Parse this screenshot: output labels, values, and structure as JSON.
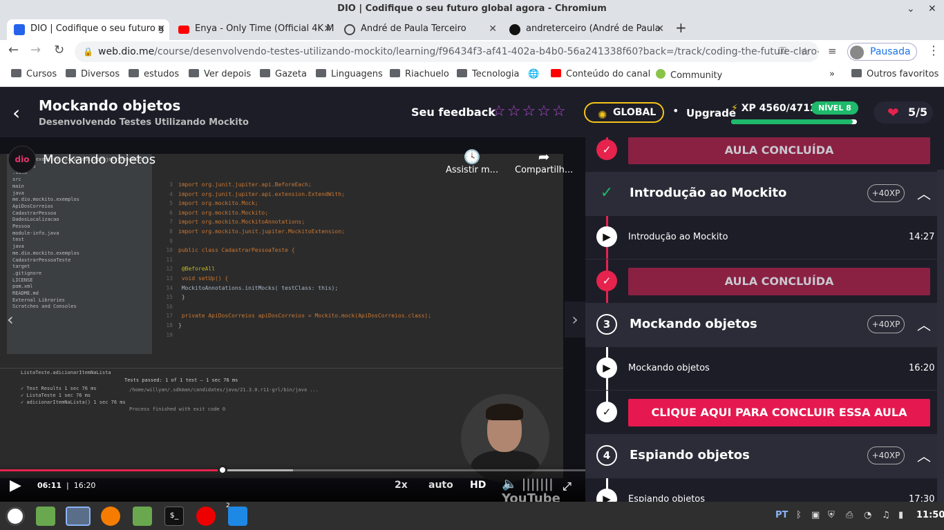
{
  "window": {
    "title": "DIO | Codifique o seu futuro global agora - Chromium"
  },
  "tabs": [
    {
      "label": "DIO | Codifique o seu futuro g",
      "color": "#2563eb"
    },
    {
      "label": "Enya - Only Time (Official 4K M",
      "color": "#ff0000"
    },
    {
      "label": "André de Paula Terceiro",
      "color": "#444444"
    },
    {
      "label": "andreterceiro (André de Paula",
      "color": "#111111"
    }
  ],
  "omnibox": {
    "domain": "web.dio.me",
    "path": "/course/desenvolvendo-testes-utilizando-mockito/learning/f96434f3-af41-402a-b4b0-56a241338f60?back=/track/coding-the-future-claro-ja..."
  },
  "profile": {
    "label": "Pausada"
  },
  "bookmarks": [
    "Cursos",
    "Diversos",
    "estudos",
    "Ver depois",
    "Gazeta",
    "Linguagens",
    "Riachuelo",
    "Tecnologia",
    "Conteúdo do canal",
    "Community",
    "Outros favoritos"
  ],
  "header": {
    "title": "Mockando objetos",
    "subtitle": "Desenvolvendo Testes Utilizando Mockito",
    "feedback_label": "Seu feedback",
    "stars": "☆☆☆☆☆",
    "global_label": "GLOBAL",
    "upgrade_label": "Upgrade",
    "xp_label": "XP 4560/4712",
    "xp_progress": 0.968,
    "level_label": "NÍVEL 8",
    "lives": "5/5"
  },
  "video": {
    "logo": "dio",
    "title": "Mockando objetos",
    "watch_label": "Assistir m...",
    "share_label": "Compartilh...",
    "current_time": "06:11",
    "separator": "|",
    "duration": "16:20",
    "progress": 0.38,
    "buffered": 0.5,
    "speed": "2x",
    "quality_mode": "auto",
    "hd": "HD",
    "youtube": "YouTube"
  },
  "ide": {
    "tree": [
      "mockito-exemplos ~/dev/tools/projects/mockito-exemplos",
      ".idea",
      "src",
      "main",
      "java",
      "me.dio.mockito.exemplos",
      "ApiDosCorreios",
      "CadastrarPessoa",
      "DadosLocalizacao",
      "Pessoa",
      "module-info.java",
      "test",
      "java",
      "me.dio.mockito.exemplos",
      "CadastrarPessoaTeste",
      "target",
      ".gitignore",
      "LICENSE",
      "pom.xml",
      "README.md",
      "External Libraries",
      "Scratches and Consoles"
    ],
    "code": [
      {
        "n": "3",
        "t": "import org.junit.jupiter.api.BeforeEach;"
      },
      {
        "n": "4",
        "t": "import org.junit.jupiter.api.extension.ExtendWith;"
      },
      {
        "n": "5",
        "t": "import org.mockito.Mock;"
      },
      {
        "n": "6",
        "t": "import org.mockito.Mockito;"
      },
      {
        "n": "7",
        "t": "import org.mockito.MockitoAnnotations;"
      },
      {
        "n": "8",
        "t": "import org.mockito.junit.jupiter.MockitoExtension;"
      },
      {
        "n": "9",
        "t": ""
      },
      {
        "n": "10",
        "t": "public class CadastrarPessoaTeste {"
      },
      {
        "n": "11",
        "t": ""
      },
      {
        "n": "12",
        "t": "    @BeforeAll"
      },
      {
        "n": "13",
        "t": "    void setUp() {"
      },
      {
        "n": "14",
        "t": "        MockitoAnnotations.initMocks( testClass: this);"
      },
      {
        "n": "15",
        "t": "    }"
      },
      {
        "n": "16",
        "t": ""
      },
      {
        "n": "17",
        "t": "    private ApiDosCorreios apiDosCorreios = Mockito.mock(ApiDosCorreios.class);"
      },
      {
        "n": "18",
        "t": "}"
      },
      {
        "n": "19",
        "t": ""
      }
    ],
    "run_tab": "ListaTeste.adicionarItemNaLista",
    "run_status": "Tests passed: 1 of 1 test – 1 sec 76 ms",
    "run_tree": [
      "Test Results   1 sec 76 ms",
      "ListaTeste   1 sec 76 ms",
      "adicionarItemNaLista()   1 sec 76 ms"
    ],
    "console": [
      "/home/willyan/.sdkman/candidates/java/21.3.0.r11-grl/bin/java ...",
      "",
      "Process finished with exit code 0"
    ]
  },
  "sidebar": {
    "concluded_label": "AULA CONCLUÍDA",
    "sections": [
      {
        "index": "✓",
        "title": "Introdução ao Mockito",
        "xp": "+40XP",
        "lesson": "Introdução ao Mockito",
        "duration": "14:27"
      },
      {
        "index": "3",
        "title": "Mockando objetos",
        "xp": "+40XP",
        "lesson": "Mockando objetos",
        "duration": "16:20"
      },
      {
        "index": "4",
        "title": "Espiando objetos",
        "xp": "+40XP",
        "lesson": "Espiando objetos",
        "duration": "17:30"
      }
    ],
    "complete_cta": "CLIQUE AQUI PARA CONCLUIR ESSA AULA"
  },
  "taskbar": {
    "lang": "PT",
    "clock": "11:50",
    "badge": "2"
  },
  "colors": {
    "accent": "#e5234d",
    "dark_bg": "#1d1d28",
    "level_green": "#1eb96a",
    "global_yellow": "#f5c518"
  }
}
